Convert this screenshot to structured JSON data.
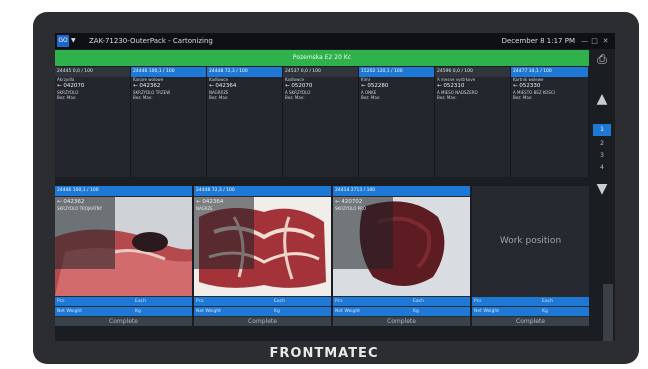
{
  "brand": "FRONTMATEC",
  "titlebar": {
    "go_label": "GO",
    "title": "ZAK-71230-OuterPack - Cartonizing",
    "date": "December 8 1:17 PM",
    "min": "—",
    "max": "□",
    "close": "✕"
  },
  "banner": "Pozemska E2 20 Kc",
  "side": {
    "pages": [
      "1",
      "2",
      "3",
      "4"
    ]
  },
  "orders": [
    {
      "head": "24445   0,0 / 100",
      "active": false,
      "lines": [
        "Akrzydla",
        "← 042070",
        "SKRZYDLO",
        "Bez: Max:"
      ]
    },
    {
      "head": "24446   100,1 / 100",
      "active": true,
      "lines": [
        "Kanare wolowe",
        "← 042362",
        "SKRZYDLO TRZEW",
        "Bez: Max:"
      ]
    },
    {
      "head": "24448   72,3 / 100",
      "active": true,
      "lines": [
        "Kadlowce",
        "← 042364",
        "NAGRRZE",
        "Bez: Max:"
      ]
    },
    {
      "head": "24537   0,0 / 100",
      "active": false,
      "lines": [
        "Kadlowce",
        "← 052070",
        "A SKRZYDLO",
        "Bez: Max:"
      ]
    },
    {
      "head": "15202   120,1 / 100",
      "active": true,
      "lines": [
        "Kimr",
        "← 052280",
        "A ONKE",
        "Bez: Max:"
      ]
    },
    {
      "head": "24596   0,0 / 100",
      "active": false,
      "lines": [
        "A mesne vystrkove",
        "← 052310",
        "A MIESO NADSZERO",
        "Bez: Max:"
      ]
    },
    {
      "head": "24477   34,1 / 100",
      "active": true,
      "lines": [
        "Kartnik wolewe",
        "← 052330",
        "A MIESTO BEZ KOSCI",
        "Bez: Max:"
      ]
    }
  ],
  "stations": [
    {
      "head": "24446   100,1 / 100",
      "code": "← 042362",
      "desc": "SKRZYDLO TROJKATNY",
      "field1_left": "Pcs",
      "field1_right": "Each",
      "field2_left": "Net Weight",
      "field2_right": "Kg",
      "complete": "Complete"
    },
    {
      "head": "24448   72,3 / 100",
      "code": "← 042364",
      "desc": "NAGRZE",
      "field1_left": "Pcs",
      "field1_right": "Each",
      "field2_left": "Net Weight",
      "field2_right": "Kg",
      "complete": "Complete"
    },
    {
      "head": "24414   2713 / 100",
      "code": "← 420702",
      "desc": "SKRZYDLO PRO",
      "field1_left": "Pcs",
      "field1_right": "Each",
      "field2_left": "Net Weight",
      "field2_right": "Kg",
      "complete": "Complete"
    },
    {
      "work": "Work position",
      "field1_left": "Pcs",
      "field1_right": "Each",
      "field2_left": "Net Weight",
      "field2_right": "Kg",
      "complete": "Complete"
    }
  ]
}
